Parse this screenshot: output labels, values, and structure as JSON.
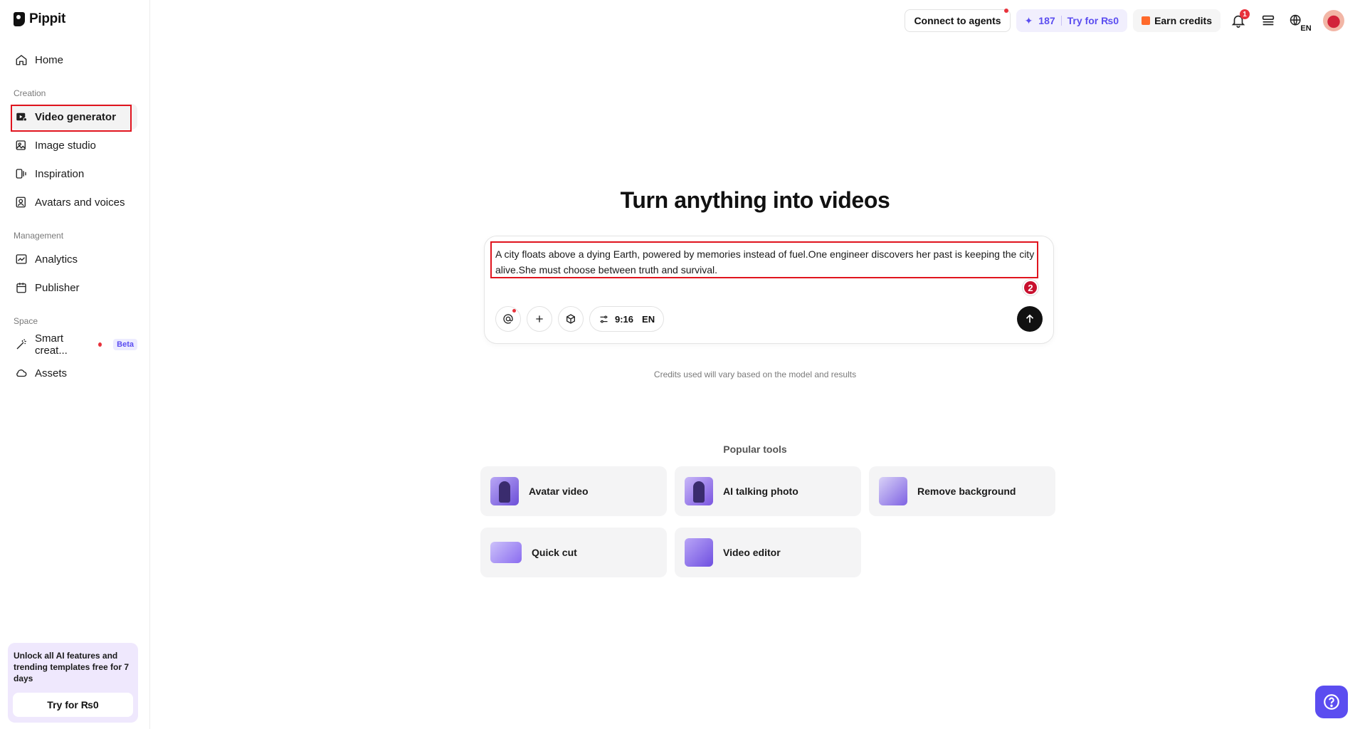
{
  "app": {
    "name": "Pippit"
  },
  "sidebar": {
    "home": "Home",
    "sections": {
      "creation": "Creation",
      "management": "Management",
      "space": "Space"
    },
    "items": {
      "video_generator": "Video generator",
      "image_studio": "Image studio",
      "inspiration": "Inspiration",
      "avatars_voices": "Avatars and voices",
      "analytics": "Analytics",
      "publisher": "Publisher",
      "smart_creation": "Smart creat...",
      "smart_creation_badge": "Beta",
      "assets": "Assets"
    },
    "promo": {
      "text": "Unlock all AI features and trending templates free for 7 days",
      "button": "Try for ₨0"
    }
  },
  "topbar": {
    "connect_agents": "Connect to agents",
    "credits_count": "187",
    "try_label": "Try for ₨0",
    "earn_credits": "Earn credits",
    "notification_count": "1",
    "language": "EN"
  },
  "main": {
    "headline": "Turn anything into videos",
    "prompt_text": "A city floats above a dying Earth, powered by memories instead of fuel.One engineer discovers her past is keeping the city alive.She must choose between truth and survival.",
    "step_badge": "2",
    "aspect_ratio": "9:16",
    "prompt_language": "EN",
    "credits_note": "Credits used will vary based on the model and results",
    "popular_title": "Popular tools",
    "tools": [
      {
        "label": "Avatar video"
      },
      {
        "label": "AI talking photo"
      },
      {
        "label": "Remove background"
      },
      {
        "label": "Quick cut"
      },
      {
        "label": "Video editor"
      }
    ]
  },
  "colors": {
    "accent": "#5b4df0",
    "highlight": "#e0141e",
    "badge": "#e8323c"
  },
  "icons": [
    "home-icon",
    "video-icon",
    "image-icon",
    "inspiration-icon",
    "avatar-icon",
    "analytics-icon",
    "calendar-icon",
    "wand-icon",
    "cloud-icon",
    "bell-icon",
    "menu-icon",
    "globe-icon",
    "at-icon",
    "plus-icon",
    "cube-icon",
    "sliders-icon",
    "arrow-up-icon",
    "help-icon"
  ]
}
